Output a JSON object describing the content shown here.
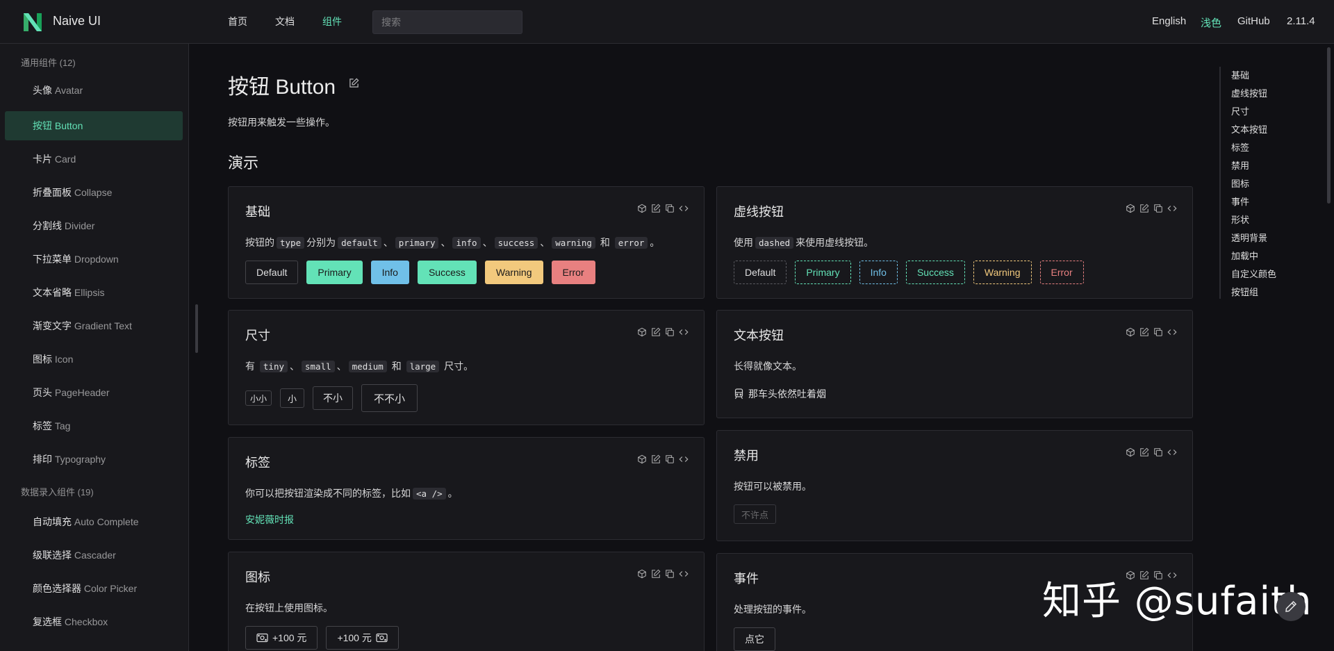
{
  "header": {
    "brand": "Naive UI",
    "nav": [
      "首页",
      "文档",
      "组件"
    ],
    "search_placeholder": "搜索",
    "right": [
      "English",
      "浅色",
      "GitHub",
      "2.11.4"
    ]
  },
  "sidebar": {
    "group1": "通用组件 (12)",
    "items1": [
      {
        "cn": "头像",
        "en": "Avatar"
      },
      {
        "cn": "按钮",
        "en": "Button"
      },
      {
        "cn": "卡片",
        "en": "Card"
      },
      {
        "cn": "折叠面板",
        "en": "Collapse"
      },
      {
        "cn": "分割线",
        "en": "Divider"
      },
      {
        "cn": "下拉菜单",
        "en": "Dropdown"
      },
      {
        "cn": "文本省略",
        "en": "Ellipsis"
      },
      {
        "cn": "渐变文字",
        "en": "Gradient Text"
      },
      {
        "cn": "图标",
        "en": "Icon"
      },
      {
        "cn": "页头",
        "en": "PageHeader"
      },
      {
        "cn": "标签",
        "en": "Tag"
      },
      {
        "cn": "排印",
        "en": "Typography"
      }
    ],
    "group2": "数据录入组件 (19)",
    "items2": [
      {
        "cn": "自动填充",
        "en": "Auto Complete"
      },
      {
        "cn": "级联选择",
        "en": "Cascader"
      },
      {
        "cn": "颜色选择器",
        "en": "Color Picker"
      },
      {
        "cn": "复选框",
        "en": "Checkbox"
      }
    ]
  },
  "main": {
    "title": "按钮 Button",
    "desc": "按钮用来触发一些操作。",
    "section": "演示"
  },
  "cards": {
    "basic": {
      "title": "基础",
      "d1": "按钮的",
      "c1": "type",
      "d2": "分别为",
      "c2": "default",
      "s1": "、",
      "c3": "primary",
      "s2": "、",
      "c4": "info",
      "s3": "、",
      "c5": "success",
      "s4": "、",
      "c6": "warning",
      "d3": "和",
      "c7": "error",
      "d4": "。",
      "buttons": [
        "Default",
        "Primary",
        "Info",
        "Success",
        "Warning",
        "Error"
      ]
    },
    "dashed": {
      "title": "虚线按钮",
      "d1": "使用",
      "c1": "dashed",
      "d2": "来使用虚线按钮。",
      "buttons": [
        "Default",
        "Primary",
        "Info",
        "Success",
        "Warning",
        "Error"
      ]
    },
    "size": {
      "title": "尺寸",
      "d1": "有",
      "c1": "tiny",
      "s1": "、",
      "c2": "small",
      "s2": "、",
      "c3": "medium",
      "d2": "和",
      "c4": "large",
      "d3": "尺寸。",
      "buttons": [
        "小小",
        "小",
        "不小",
        "不不小"
      ]
    },
    "text": {
      "title": "文本按钮",
      "desc": "长得就像文本。",
      "button": "那车头依然吐着烟"
    },
    "tag": {
      "title": "标签",
      "d1": "你可以把按钮渲染成不同的标签，比如",
      "c1": "<a />",
      "d2": "。",
      "link": "安妮薇时报"
    },
    "disabled": {
      "title": "禁用",
      "desc": "按钮可以被禁用。",
      "button": "不许点"
    },
    "icon": {
      "title": "图标",
      "desc": "在按钮上使用图标。",
      "buttons": [
        "+100 元",
        "+100 元"
      ]
    },
    "event": {
      "title": "事件",
      "desc": "处理按钮的事件。",
      "button": "点它"
    }
  },
  "anchor": [
    "基础",
    "虚线按钮",
    "尺寸",
    "文本按钮",
    "标签",
    "禁用",
    "图标",
    "事件",
    "形状",
    "透明背景",
    "加载中",
    "自定义颜色",
    "按钮组"
  ],
  "watermark": "知乎 @sufaith",
  "colors": {
    "primary": "#63e2b7",
    "info": "#70c0e8",
    "warning": "#f2c97d",
    "error": "#e88080",
    "bg": "#101014",
    "card": "#18181c"
  }
}
